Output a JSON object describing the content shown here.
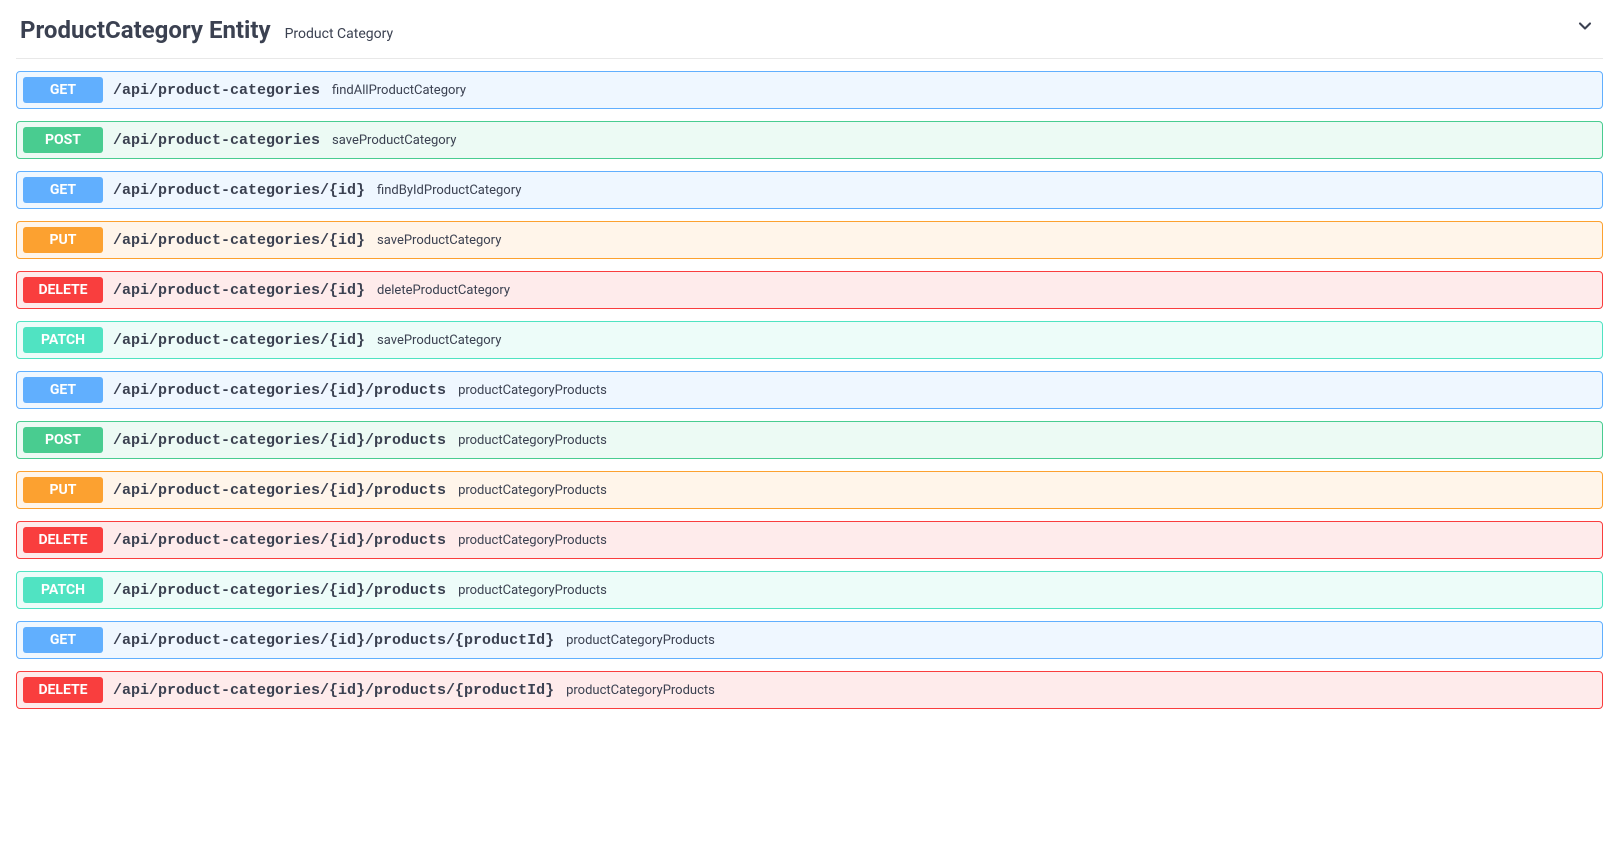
{
  "section": {
    "title": "ProductCategory Entity",
    "subtitle": "Product Category"
  },
  "operations": [
    {
      "method": "GET",
      "path": "/api/product-categories",
      "desc": "findAllProductCategory"
    },
    {
      "method": "POST",
      "path": "/api/product-categories",
      "desc": "saveProductCategory"
    },
    {
      "method": "GET",
      "path": "/api/product-categories/{id}",
      "desc": "findByIdProductCategory"
    },
    {
      "method": "PUT",
      "path": "/api/product-categories/{id}",
      "desc": "saveProductCategory"
    },
    {
      "method": "DELETE",
      "path": "/api/product-categories/{id}",
      "desc": "deleteProductCategory"
    },
    {
      "method": "PATCH",
      "path": "/api/product-categories/{id}",
      "desc": "saveProductCategory"
    },
    {
      "method": "GET",
      "path": "/api/product-categories/{id}/products",
      "desc": "productCategoryProducts"
    },
    {
      "method": "POST",
      "path": "/api/product-categories/{id}/products",
      "desc": "productCategoryProducts"
    },
    {
      "method": "PUT",
      "path": "/api/product-categories/{id}/products",
      "desc": "productCategoryProducts"
    },
    {
      "method": "DELETE",
      "path": "/api/product-categories/{id}/products",
      "desc": "productCategoryProducts"
    },
    {
      "method": "PATCH",
      "path": "/api/product-categories/{id}/products",
      "desc": "productCategoryProducts"
    },
    {
      "method": "GET",
      "path": "/api/product-categories/{id}/products/{productId}",
      "desc": "productCategoryProducts"
    },
    {
      "method": "DELETE",
      "path": "/api/product-categories/{id}/products/{productId}",
      "desc": "productCategoryProducts"
    }
  ]
}
